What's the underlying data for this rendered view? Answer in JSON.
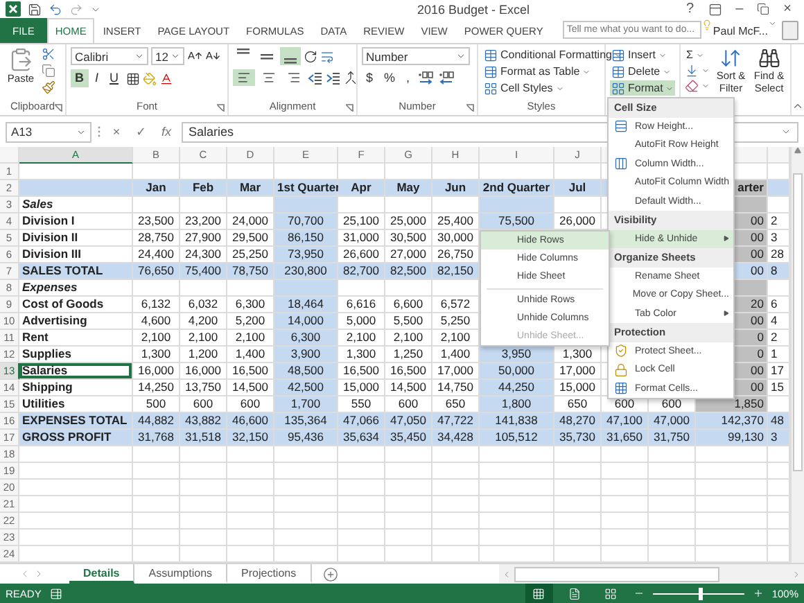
{
  "window": {
    "title": "2016 Budget - Excel",
    "help": "?",
    "minimize": "–",
    "close": "×"
  },
  "ribbon_tabs": [
    {
      "label": "FILE",
      "kind": "file",
      "selected": false
    },
    {
      "label": "HOME",
      "kind": "tab",
      "selected": true
    },
    {
      "label": "INSERT",
      "kind": "tab",
      "selected": false
    },
    {
      "label": "PAGE LAYOUT",
      "kind": "tab",
      "selected": false
    },
    {
      "label": "FORMULAS",
      "kind": "tab",
      "selected": false
    },
    {
      "label": "DATA",
      "kind": "tab",
      "selected": false
    },
    {
      "label": "REVIEW",
      "kind": "tab",
      "selected": false
    },
    {
      "label": "VIEW",
      "kind": "tab",
      "selected": false
    },
    {
      "label": "POWER QUERY",
      "kind": "tab",
      "selected": false
    }
  ],
  "search": {
    "placeholder": "Tell me what you want to do..."
  },
  "account": {
    "name": "Paul McF..."
  },
  "clipboard": {
    "paste": "Paste",
    "label": "Clipboard"
  },
  "font": {
    "name": "Calibri",
    "size": "12",
    "label": "Font",
    "styles": [
      {
        "label": "B",
        "kind": "bold",
        "selected": true
      },
      {
        "label": "I",
        "kind": "italic",
        "selected": false
      },
      {
        "label": "U",
        "kind": "underline",
        "selected": false
      }
    ]
  },
  "alignment": {
    "label": "Alignment",
    "vertical": [
      {
        "kind": "top",
        "selected": false
      },
      {
        "kind": "middle",
        "selected": false
      },
      {
        "kind": "bottom",
        "selected": true
      }
    ],
    "horizontal": [
      {
        "kind": "left",
        "selected": true
      },
      {
        "kind": "center",
        "selected": false
      },
      {
        "kind": "right",
        "selected": false
      }
    ]
  },
  "number": {
    "format": "Number",
    "label": "Number",
    "buttons": [
      "$",
      "%",
      ","
    ]
  },
  "styles": {
    "label": "Styles",
    "items": [
      "Conditional Formatting",
      "Format as Table",
      "Cell Styles"
    ]
  },
  "cells": {
    "items": [
      {
        "label": "Insert",
        "selected": false
      },
      {
        "label": "Delete",
        "selected": false
      },
      {
        "label": "Format",
        "selected": true
      }
    ]
  },
  "editing": {
    "sum": "Σ",
    "sort": "Sort & Filter",
    "find": "Find & Select"
  },
  "formula_bar": {
    "name_box": "A13",
    "cancel": "×",
    "enter": "✓",
    "function": "fx",
    "value": "Salaries"
  },
  "columns": [
    {
      "header": "A",
      "kind": "label",
      "selected": true
    },
    {
      "header": "B",
      "kind": "month",
      "selected": false
    },
    {
      "header": "C",
      "kind": "month",
      "selected": false
    },
    {
      "header": "D",
      "kind": "month",
      "selected": false
    },
    {
      "header": "E",
      "kind": "quarter",
      "selected": false
    },
    {
      "header": "F",
      "kind": "month",
      "selected": false
    },
    {
      "header": "G",
      "kind": "month",
      "selected": false
    },
    {
      "header": "H",
      "kind": "month",
      "selected": false
    },
    {
      "header": "I",
      "kind": "quarter",
      "selected": false
    },
    {
      "header": "J",
      "kind": "month",
      "selected": false
    },
    {
      "kind": "month"
    },
    {
      "kind": "month"
    },
    {
      "kind": "shaded",
      "selected": false
    },
    {
      "kind": "cut",
      "selected": false
    }
  ],
  "rows": [
    {
      "number": "1",
      "kind": "blank",
      "selected": false
    },
    {
      "number": "2",
      "kind": "header",
      "selected": false,
      "cells": [
        null,
        "Jan",
        "Feb",
        "Mar",
        "1st Quarter",
        "Apr",
        "May",
        "Jun",
        "2nd Quarter",
        "Jul",
        null,
        null,
        "arter",
        null
      ]
    },
    {
      "number": "3",
      "kind": "section",
      "selected": false,
      "cells": [
        "Sales"
      ]
    },
    {
      "number": "4",
      "kind": "item",
      "selected": false,
      "cells": [
        "Division I",
        "23,500",
        "23,200",
        "24,000",
        "70,700",
        "25,100",
        "25,000",
        "25,400",
        "75,500",
        "26,000",
        null,
        null,
        "00",
        "2"
      ]
    },
    {
      "number": "5",
      "kind": "item",
      "selected": false,
      "cells": [
        "Division II",
        "28,750",
        "27,900",
        "29,500",
        "86,150",
        "31,000",
        "30,500",
        "30,000",
        null,
        null,
        null,
        null,
        "00",
        "3"
      ]
    },
    {
      "number": "6",
      "kind": "item",
      "selected": false,
      "cells": [
        "Division III",
        "24,400",
        "24,300",
        "25,250",
        "73,950",
        "26,600",
        "27,000",
        "26,750",
        null,
        null,
        null,
        null,
        "00",
        "28"
      ]
    },
    {
      "number": "7",
      "kind": "total",
      "selected": false,
      "cells": [
        "SALES TOTAL",
        "76,650",
        "75,400",
        "78,750",
        "230,800",
        "82,700",
        "82,500",
        "82,150",
        null,
        null,
        null,
        null,
        "00",
        "8"
      ]
    },
    {
      "number": "8",
      "kind": "section",
      "selected": false,
      "cells": [
        "Expenses"
      ]
    },
    {
      "number": "9",
      "kind": "item",
      "selected": false,
      "cells": [
        "Cost of Goods",
        "6,132",
        "6,032",
        "6,300",
        "18,464",
        "6,616",
        "6,600",
        "6,572",
        null,
        null,
        null,
        null,
        "20",
        "6"
      ]
    },
    {
      "number": "10",
      "kind": "item",
      "selected": false,
      "cells": [
        "Advertising",
        "4,600",
        "4,200",
        "5,200",
        "14,000",
        "5,000",
        "5,500",
        "5,250",
        null,
        null,
        null,
        null,
        "00",
        "4"
      ]
    },
    {
      "number": "11",
      "kind": "item",
      "selected": false,
      "cells": [
        "Rent",
        "2,100",
        "2,100",
        "2,100",
        "6,300",
        "2,100",
        "2,100",
        "2,100",
        null,
        null,
        null,
        null,
        "0",
        "2"
      ]
    },
    {
      "number": "12",
      "kind": "item",
      "selected": false,
      "cells": [
        "Supplies",
        "1,300",
        "1,200",
        "1,400",
        "3,900",
        "1,300",
        "1,250",
        "1,400",
        "3,950",
        "1,300",
        null,
        null,
        "0",
        "1"
      ]
    },
    {
      "number": "13",
      "kind": "item",
      "selected": true,
      "cells": [
        "Salaries",
        "16,000",
        "16,000",
        "16,500",
        "48,500",
        "16,500",
        "16,500",
        "17,000",
        "50,000",
        "17,000",
        null,
        null,
        "00",
        "17"
      ]
    },
    {
      "number": "14",
      "kind": "item",
      "selected": false,
      "cells": [
        "Shipping",
        "14,250",
        "13,750",
        "14,500",
        "42,500",
        "15,000",
        "14,500",
        "14,750",
        "44,250",
        "15,000",
        null,
        null,
        "00",
        "15"
      ]
    },
    {
      "number": "15",
      "kind": "item",
      "selected": false,
      "cells": [
        "Utilities",
        "500",
        "600",
        "600",
        "1,700",
        "550",
        "600",
        "650",
        "1,800",
        "650",
        "600",
        "600",
        "1,850"
      ]
    },
    {
      "number": "16",
      "kind": "total",
      "selected": false,
      "cells": [
        "EXPENSES TOTAL",
        "44,882",
        "43,882",
        "46,600",
        "135,364",
        "47,066",
        "47,050",
        "47,722",
        "141,838",
        "48,270",
        "47,100",
        "47,000",
        "142,370",
        "48"
      ]
    },
    {
      "number": "17",
      "kind": "total",
      "selected": false,
      "cells": [
        "GROSS PROFIT",
        "31,768",
        "31,518",
        "32,150",
        "95,436",
        "35,634",
        "35,450",
        "34,428",
        "105,512",
        "35,730",
        "31,650",
        "31,750",
        "99,130",
        "3"
      ]
    },
    {
      "number": "18",
      "kind": "blank",
      "selected": false
    },
    {
      "number": "19",
      "kind": "blank",
      "selected": false
    },
    {
      "number": "20",
      "kind": "blank",
      "selected": false
    },
    {
      "number": "21",
      "kind": "blank",
      "selected": false
    },
    {
      "number": "22",
      "kind": "blank",
      "selected": false
    },
    {
      "number": "23",
      "kind": "blank",
      "selected": false
    },
    {
      "number": "24",
      "kind": "blank",
      "selected": false
    }
  ],
  "format_menu": {
    "items": [
      {
        "kind": "header",
        "label": "Cell Size"
      },
      {
        "kind": "item",
        "label": "Row Height...",
        "selected": false
      },
      {
        "kind": "item",
        "label": "AutoFit Row Height",
        "selected": false
      },
      {
        "kind": "item",
        "label": "Column Width...",
        "selected": false
      },
      {
        "kind": "item",
        "label": "AutoFit Column Width",
        "selected": false
      },
      {
        "kind": "item",
        "label": "Default Width...",
        "selected": false
      },
      {
        "kind": "header",
        "label": "Visibility"
      },
      {
        "kind": "submenu",
        "label": "Hide & Unhide",
        "selected": true
      },
      {
        "kind": "header",
        "label": "Organize Sheets"
      },
      {
        "kind": "item",
        "label": "Rename Sheet",
        "selected": false
      },
      {
        "kind": "item",
        "label": "Move or Copy Sheet...",
        "selected": false
      },
      {
        "kind": "submenu",
        "label": "Tab Color",
        "selected": false
      },
      {
        "kind": "header",
        "label": "Protection"
      },
      {
        "kind": "item",
        "label": "Protect Sheet...",
        "selected": false
      },
      {
        "kind": "item",
        "label": "Lock Cell",
        "selected": false
      },
      {
        "kind": "item",
        "label": "Format Cells...",
        "selected": false
      }
    ]
  },
  "hide_menu": {
    "items": [
      {
        "kind": "item",
        "label": "Hide Rows",
        "selected": true,
        "disabled": false
      },
      {
        "kind": "item",
        "label": "Hide Columns",
        "selected": false,
        "disabled": false
      },
      {
        "kind": "item",
        "label": "Hide Sheet",
        "selected": false,
        "disabled": false
      },
      {
        "kind": "separator"
      },
      {
        "kind": "item",
        "label": "Unhide Rows",
        "selected": false,
        "disabled": false
      },
      {
        "kind": "item",
        "label": "Unhide Columns",
        "selected": false,
        "disabled": false
      },
      {
        "kind": "item",
        "label": "Unhide Sheet...",
        "selected": false,
        "disabled": true
      }
    ]
  },
  "sheets": [
    {
      "label": "Details",
      "selected": true
    },
    {
      "label": "Assumptions",
      "selected": false
    },
    {
      "label": "Projections",
      "selected": false
    }
  ],
  "status_bar": {
    "mode": "READY",
    "views": [
      {
        "kind": "normal",
        "selected": true
      },
      {
        "kind": "page-layout",
        "selected": false
      },
      {
        "kind": "page-break",
        "selected": false
      }
    ],
    "zoom": {
      "level": 0.5,
      "reading": "100%"
    }
  }
}
